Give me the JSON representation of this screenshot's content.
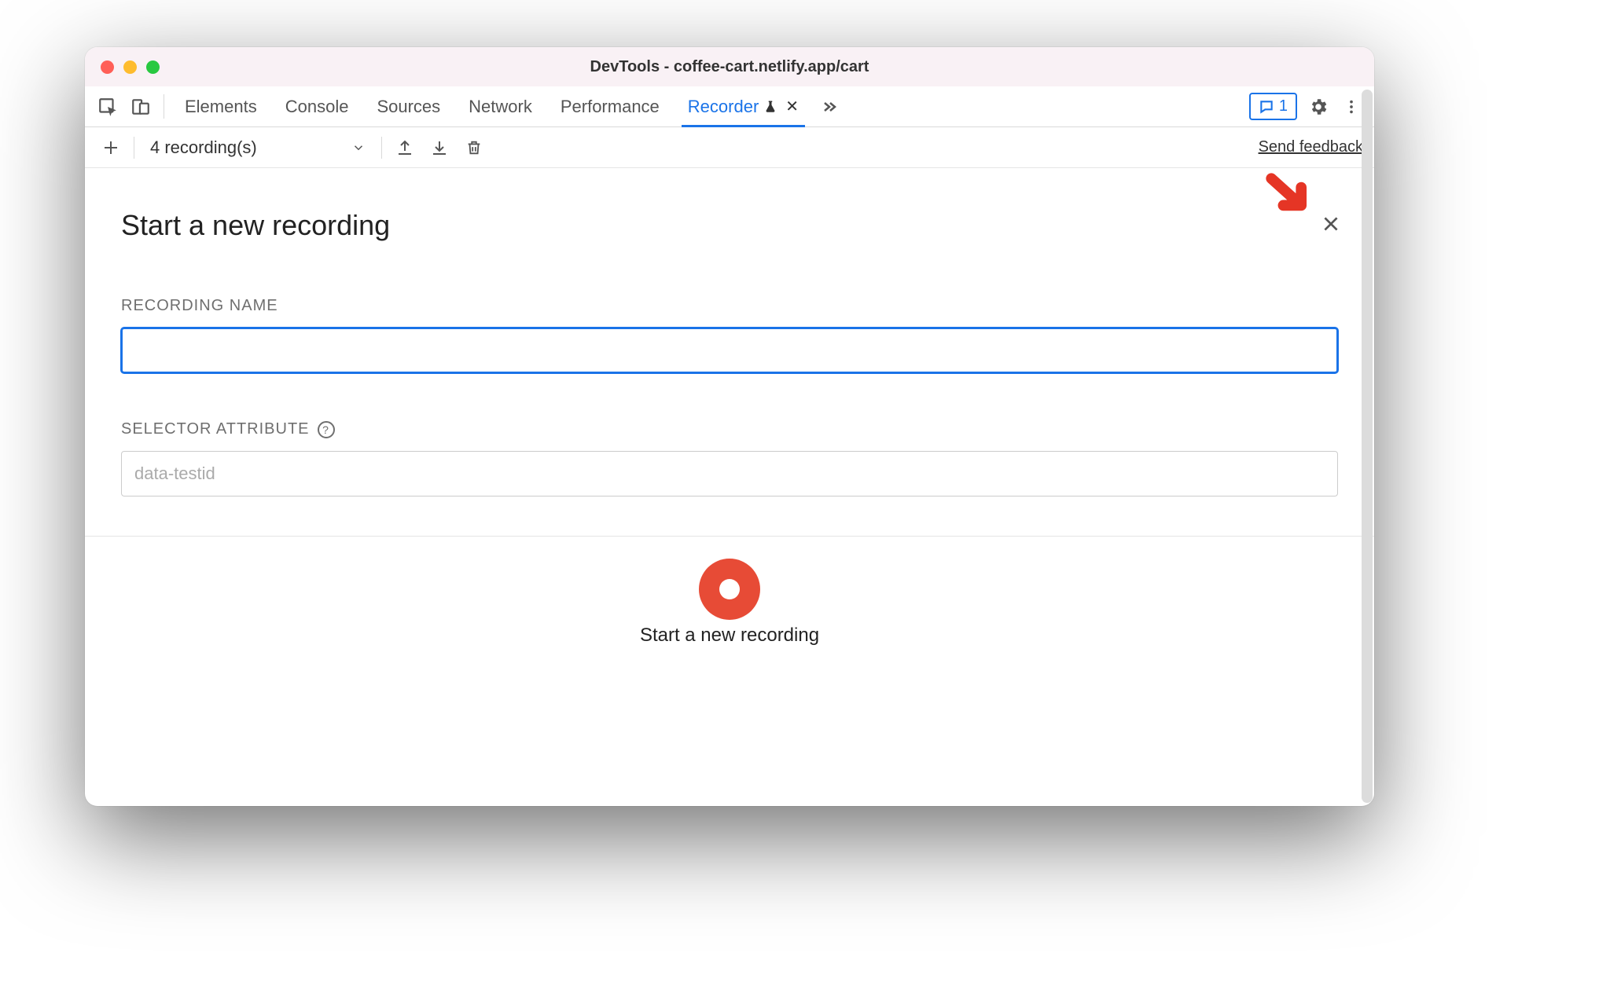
{
  "window": {
    "title": "DevTools - coffee-cart.netlify.app/cart"
  },
  "tabs": {
    "items": [
      "Elements",
      "Console",
      "Sources",
      "Network",
      "Performance",
      "Recorder"
    ],
    "active_index": 5
  },
  "issues": {
    "count": "1"
  },
  "toolbar": {
    "recordings_label": "4 recording(s)",
    "send_feedback": "Send feedback"
  },
  "panel": {
    "title": "Start a new recording",
    "fields": {
      "recording_name": {
        "label": "RECORDING NAME",
        "value": ""
      },
      "selector_attribute": {
        "label": "SELECTOR ATTRIBUTE",
        "placeholder": "data-testid",
        "value": ""
      }
    }
  },
  "record": {
    "label": "Start a new recording"
  },
  "colors": {
    "accent": "#1a73e8",
    "record": "#e74b36",
    "annotation": "#e53525"
  }
}
